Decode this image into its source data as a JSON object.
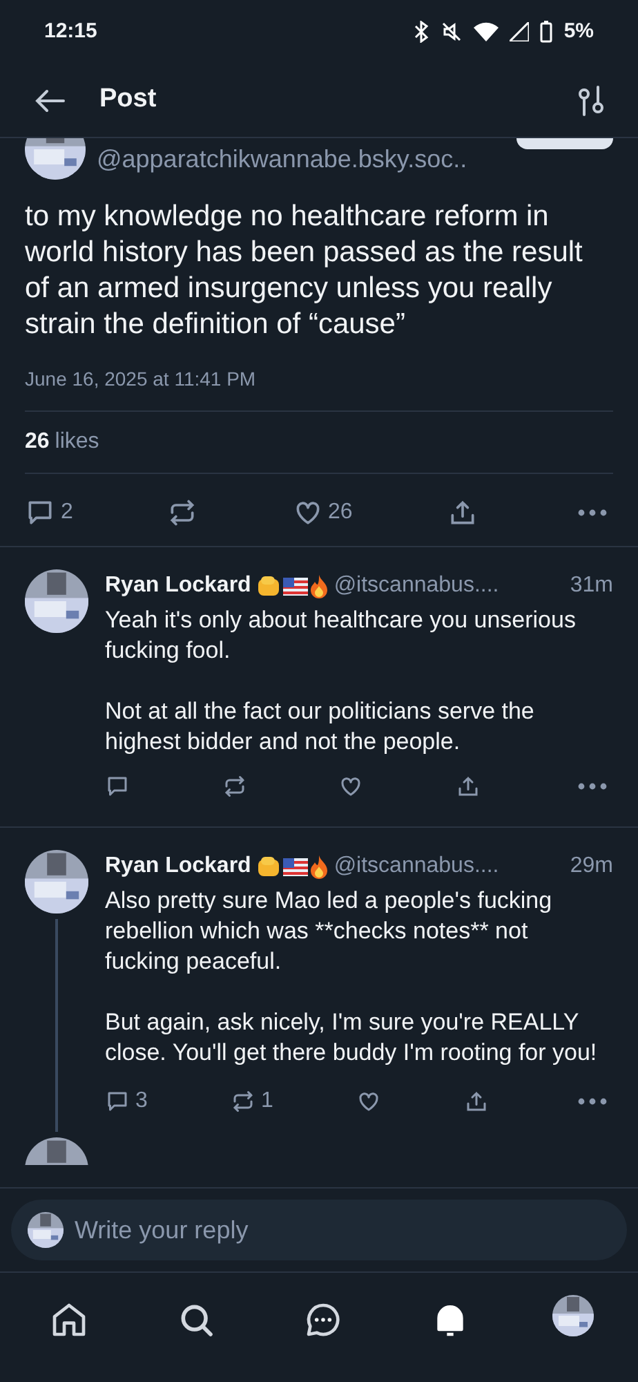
{
  "status_bar": {
    "time": "12:15",
    "battery": "5%"
  },
  "header": {
    "title": "Post"
  },
  "post": {
    "handle": "@apparatchikwannabe.bsky.soc..",
    "text": "to my knowledge no healthcare reform in world history has been passed as the result of an armed insurgency unless you really strain the definition of “cause”",
    "date": "June 16, 2025 at 11:41 PM",
    "likes_count": "26",
    "likes_label": "likes",
    "replies": "2",
    "likes": "26"
  },
  "replies": [
    {
      "name": "Ryan Lockard",
      "handle": "@itscannabus....",
      "time": "31m",
      "paragraphs": [
        "Yeah it's only about healthcare you unserious fucking fool.",
        "Not at all the fact our politicians serve the highest bidder and not the people."
      ],
      "thread": false
    },
    {
      "name": "Ryan Lockard",
      "handle": "@itscannabus....",
      "time": "29m",
      "paragraphs": [
        "Also pretty sure Mao led a people's fucking rebellion which was **checks notes** not fucking peaceful.",
        "But again, ask nicely, I'm sure you're REALLY close. You'll get there buddy I'm rooting for you!"
      ],
      "replies": "3",
      "reposts": "1",
      "thread": true
    }
  ],
  "composer": {
    "placeholder": "Write your reply"
  },
  "nav": [
    {
      "kind": "home",
      "selected": false
    },
    {
      "kind": "search",
      "selected": false
    },
    {
      "kind": "chat",
      "selected": false
    },
    {
      "kind": "bell",
      "selected": true
    },
    {
      "kind": "avatar",
      "selected": false
    }
  ]
}
